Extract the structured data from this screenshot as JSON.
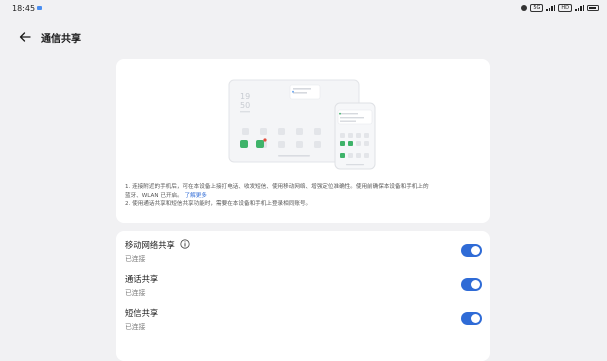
{
  "status_bar": {
    "time": "18:45",
    "right_indicators": [
      "5G",
      "HD"
    ]
  },
  "header": {
    "title": "通信共享",
    "back_icon": "arrow-left-icon"
  },
  "illustration": {
    "tablet_time_hour": "19",
    "tablet_time_min": "50"
  },
  "intro": {
    "line1": "1. 连接附近的手机后，可在本设备上接打电话、收发短信、使用移动网络、增强定位准确性。使用前确保本设备和手机上的",
    "line2_prefix": "蓝牙、WLAN 已开启。",
    "learn_more": "了解更多",
    "line3": "2. 使用通话共享和短信共享功能时，需要在本设备和手机上登录相同账号。"
  },
  "settings": {
    "rows": [
      {
        "title": "移动网络共享",
        "subtitle": "已连接",
        "has_info": true,
        "enabled": true
      },
      {
        "title": "通话共享",
        "subtitle": "已连接",
        "has_info": false,
        "enabled": true
      },
      {
        "title": "短信共享",
        "subtitle": "已连接",
        "has_info": false,
        "enabled": true
      }
    ]
  },
  "colors": {
    "accent": "#2f6bd6",
    "background": "#f1f1f3",
    "card": "#ffffff"
  }
}
